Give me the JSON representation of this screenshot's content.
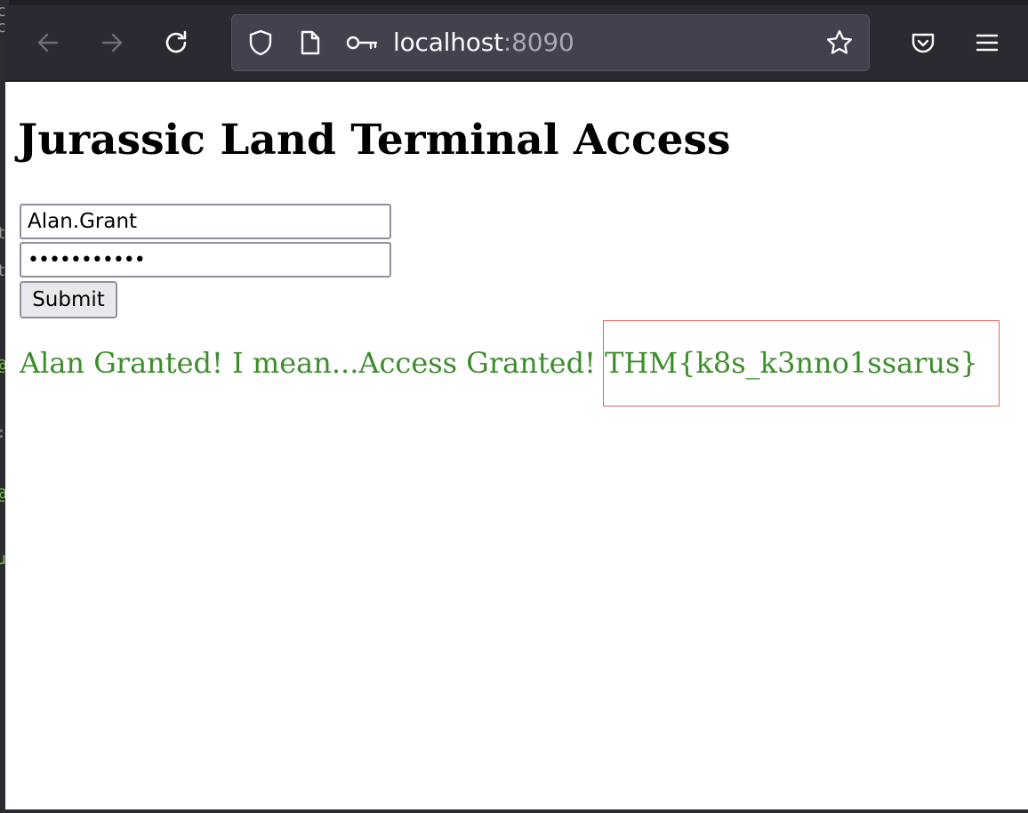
{
  "browser": {
    "url_host": "localhost",
    "url_port": ":8090"
  },
  "page": {
    "title": "Jurassic Land Terminal Access",
    "username_value": "Alan.Grant",
    "password_value": "•••••••••••",
    "submit_label": "Submit",
    "message": "Alan Granted! I mean...Access Granted! THM{k8s_k3nno1ssarus}"
  },
  "colors": {
    "message_text": "#3c8d2b",
    "highlight_box": "#e0655a",
    "toolbar_bg": "#2b2a33"
  }
}
